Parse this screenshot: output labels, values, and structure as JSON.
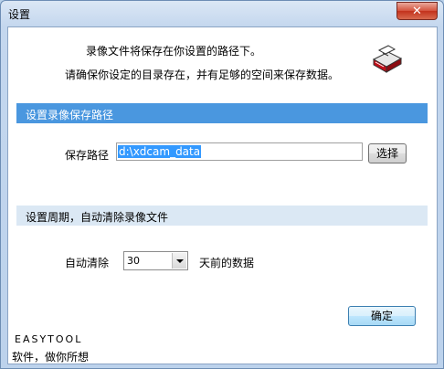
{
  "window": {
    "title": "设置",
    "close_glyph": "✕"
  },
  "intro": {
    "line1": "录像文件将保存在你设置的路径下。",
    "line2": "请确保你设定的目录存在，并有足够的空间来保存数据。",
    "icon": "hard-drive-icon"
  },
  "path_section": {
    "heading": "设置录像保存路径",
    "label": "保存路径",
    "value": "d:\\xdcam_data",
    "choose_button": "选择"
  },
  "cleanup_section": {
    "heading": "设置周期，自动清除录像文件",
    "label": "自动清除",
    "days_selected": "30",
    "suffix": "天前的数据"
  },
  "ok_button": "确定",
  "footer": {
    "brand": "EASYTOOL",
    "slogan": "软件，做你所想"
  },
  "colors": {
    "section_blue": "#4a97df",
    "section_light": "#dbe8f4",
    "close_red": "#c3321c",
    "selection": "#3399ff"
  }
}
